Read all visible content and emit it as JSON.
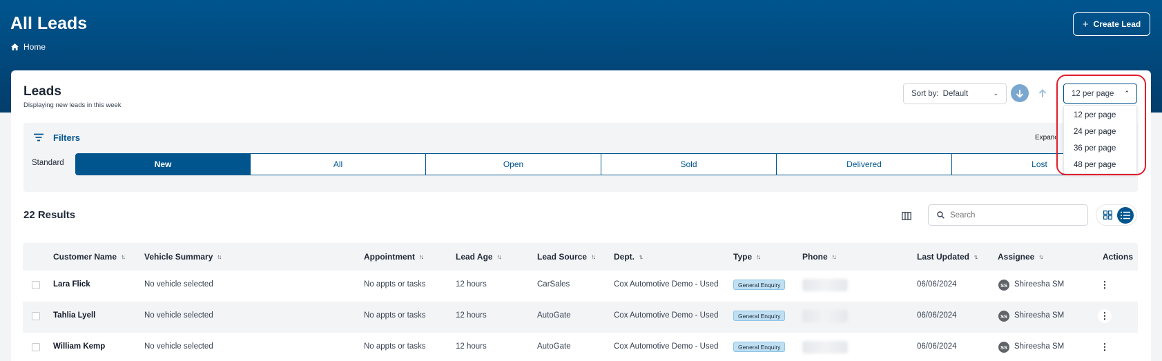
{
  "header": {
    "title": "All Leads",
    "breadcrumb": "Home",
    "create_button": "Create Lead"
  },
  "leads_panel": {
    "title": "Leads",
    "subtitle": "Displaying new leads in this week",
    "sort_label": "Sort by:",
    "sort_value": "Default",
    "per_page_value": "12 per page",
    "per_page_options": [
      "12 per page",
      "24 per page",
      "36 per page",
      "48 per page"
    ]
  },
  "filters": {
    "label": "Filters",
    "expand_label": "Expand All",
    "standard_label": "Standard",
    "tabs": [
      "New",
      "All",
      "Open",
      "Sold",
      "Delivered",
      "Lost"
    ],
    "active_tab": "New"
  },
  "results": {
    "count_label": "22 Results",
    "search_placeholder": "Search"
  },
  "table": {
    "columns": [
      "Customer Name",
      "Vehicle Summary",
      "Appointment",
      "Lead Age",
      "Lead Source",
      "Dept.",
      "Type",
      "Phone",
      "Last Updated",
      "Assignee",
      "Actions"
    ],
    "rows": [
      {
        "name": "Lara Flick",
        "vehicle": "No vehicle selected",
        "appointment": "No appts or tasks",
        "age": "12 hours",
        "source": "CarSales",
        "dept": "Cox Automotive Demo - Used",
        "type": "General Enquiry",
        "updated": "06/06/2024",
        "assignee_initials": "SS",
        "assignee": "Shireesha SM"
      },
      {
        "name": "Tahlia Lyell",
        "vehicle": "No vehicle selected",
        "appointment": "No appts or tasks",
        "age": "12 hours",
        "source": "AutoGate",
        "dept": "Cox Automotive Demo - Used",
        "type": "General Enquiry",
        "updated": "06/06/2024",
        "assignee_initials": "SS",
        "assignee": "Shireesha SM"
      },
      {
        "name": "William Kemp",
        "vehicle": "No vehicle selected",
        "appointment": "No appts or tasks",
        "age": "12 hours",
        "source": "AutoGate",
        "dept": "Cox Automotive Demo - Used",
        "type": "General Enquiry",
        "updated": "06/06/2024",
        "assignee_initials": "SS",
        "assignee": "Shireesha SM"
      }
    ]
  },
  "colors": {
    "brand": "#00558f",
    "highlight": "#e11d2b",
    "badge": "#bfe0f3"
  }
}
